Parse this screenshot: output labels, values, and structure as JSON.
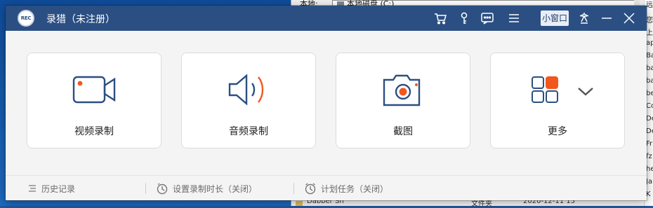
{
  "background": {
    "address_label": "本地:",
    "address_value": "本地磁盘 (C:)",
    "right_column": [
      "远",
      "您",
      "上",
      "ap",
      "Ba",
      "ba",
      "ba",
      "be",
      "Co",
      "De",
      "De",
      "Fr",
      "fz",
      "he",
      "Ja",
      "K"
    ],
    "bottom_row": {
      "name": "Dabber Sh",
      "type": "文件夹",
      "date": "2020-12-11 15"
    }
  },
  "app": {
    "title": "录猎（未注册）",
    "logo_text": "REC",
    "mini_window_label": "小窗口",
    "accent_color": "#2b4f83",
    "highlight_color": "#f2571e"
  },
  "cards": [
    {
      "label": "视频录制",
      "icon": "video-camera-icon"
    },
    {
      "label": "音频录制",
      "icon": "speaker-icon"
    },
    {
      "label": "截图",
      "icon": "photo-camera-icon"
    },
    {
      "label": "更多",
      "icon": "grid-more-icon"
    }
  ],
  "statusbar": {
    "history_label": "历史记录",
    "duration_label": "设置录制时长（关闭）",
    "schedule_label": "计划任务（关闭）"
  }
}
